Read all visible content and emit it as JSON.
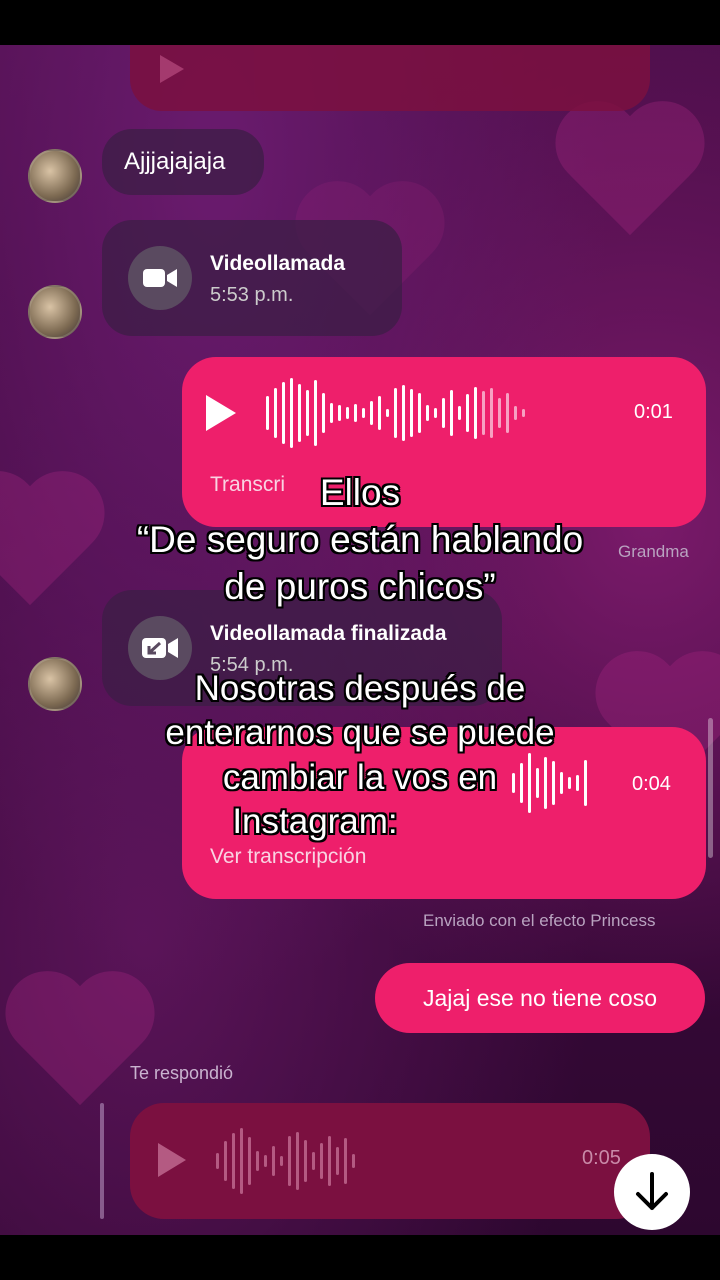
{
  "chat": {
    "msg1": "Ajjjajajaja",
    "call1": {
      "title": "Videollamada",
      "time": "5:53 p.m."
    },
    "voice1": {
      "duration": "0:01",
      "transcript_label": "Transcri"
    },
    "voice1_meta": "Grandma",
    "call2": {
      "title": "Videollamada finalizada",
      "time": "5:54 p.m."
    },
    "voice2": {
      "duration": "0:04",
      "transcript_label": "Ver transcripción"
    },
    "voice2_meta": "Enviado con el efecto Princess",
    "sent_text": "Jajaj ese no tiene coso",
    "reply_label": "Te respondió",
    "voice3": {
      "duration": "0:05"
    }
  },
  "captions": {
    "line_title": "Ellos",
    "line_quote1": "“De seguro están hablando",
    "line_quote2": "de puros chicos”",
    "line_b1": "Nosotras después de",
    "line_b2": "enterarnos que se puede",
    "line_b3": "cambiar la vos en",
    "line_b4": "Instagram:"
  },
  "colors": {
    "accent": "#ee1f6b",
    "background": "#4e0f4c"
  },
  "icons": [
    "play-icon",
    "video-camera-icon",
    "missed-video-icon",
    "arrow-down-icon"
  ]
}
